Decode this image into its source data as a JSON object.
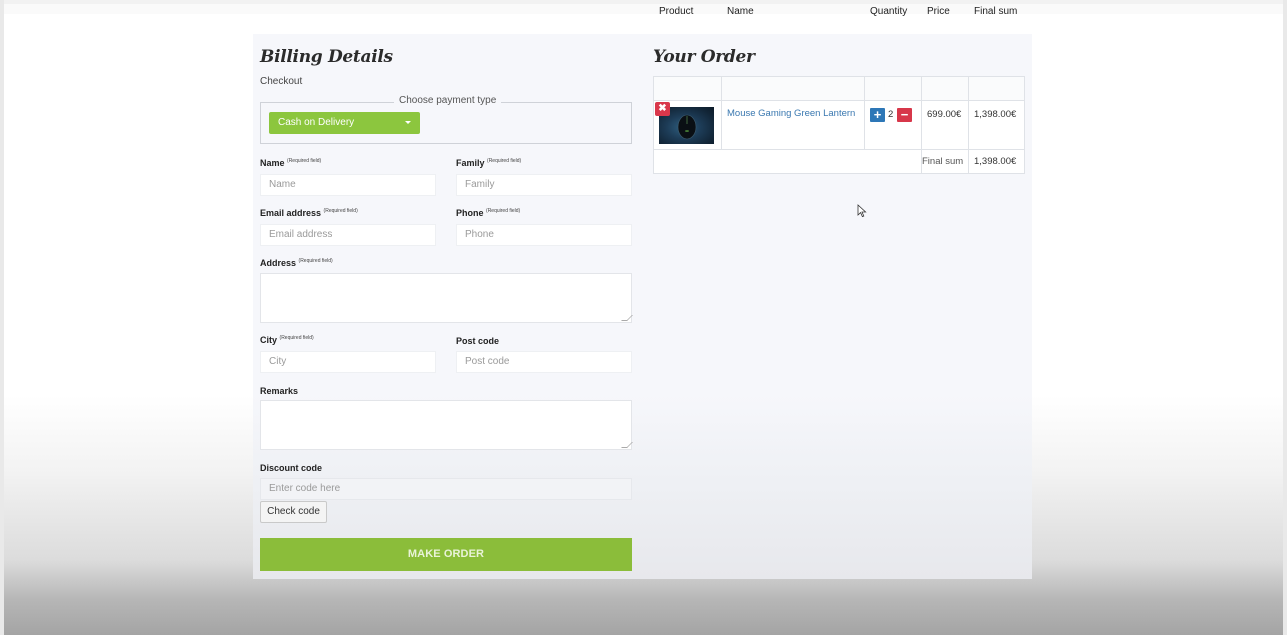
{
  "billing": {
    "title": "Billing Details",
    "subtitle": "Checkout",
    "payment_legend": "Choose payment type",
    "payment_selected": "Cash on Delivery",
    "required_tag": "(Required field)",
    "fields": {
      "name": {
        "label": "Name",
        "placeholder": "Name"
      },
      "family": {
        "label": "Family",
        "placeholder": "Family"
      },
      "email": {
        "label": "Email address",
        "placeholder": "Email address"
      },
      "phone": {
        "label": "Phone",
        "placeholder": "Phone"
      },
      "address": {
        "label": "Address"
      },
      "city": {
        "label": "City",
        "placeholder": "City"
      },
      "postcode": {
        "label": "Post code",
        "placeholder": "Post code"
      },
      "remarks": {
        "label": "Remarks"
      },
      "discount": {
        "label": "Discount code",
        "placeholder": "Enter code here"
      }
    },
    "check_code_label": "Check code",
    "make_order_label": "MAKE ORDER"
  },
  "order": {
    "title": "Your Order",
    "columns": [
      "Product",
      "Name",
      "Quantity",
      "Price",
      "Final sum"
    ],
    "items": [
      {
        "name": "Mouse Gaming Green Lantern",
        "quantity": "2",
        "price": "699.00€",
        "final_sum": "1,398.00€"
      }
    ],
    "total_label": "Final sum",
    "total_value": "1,398.00€",
    "remove_symbol": "✖",
    "plus_symbol": "+",
    "minus_symbol": "−"
  },
  "colors": {
    "accent_green": "#8cc63e",
    "order_button": "#8bbd3a",
    "remove_red": "#d9374b",
    "plus_blue": "#2d77b7",
    "link_blue": "#3a78b0"
  }
}
